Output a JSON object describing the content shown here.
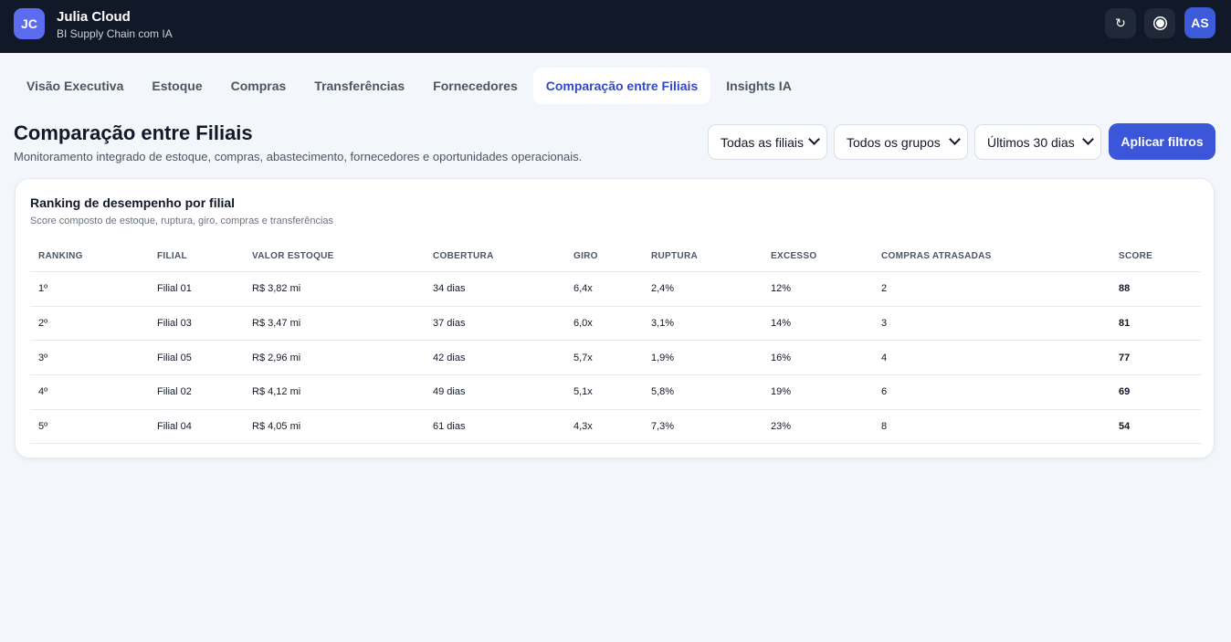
{
  "header": {
    "logo_initials": "JC",
    "app_name": "Julia Cloud",
    "app_subtitle": "BI Supply Chain com IA",
    "refresh_icon": "↻",
    "avatar_initials": "AS"
  },
  "tabs": [
    {
      "label": "Visão Executiva",
      "active": false
    },
    {
      "label": "Estoque",
      "active": false
    },
    {
      "label": "Compras",
      "active": false
    },
    {
      "label": "Transferências",
      "active": false
    },
    {
      "label": "Fornecedores",
      "active": false
    },
    {
      "label": "Comparação entre Filiais",
      "active": true
    },
    {
      "label": "Insights IA",
      "active": false
    }
  ],
  "page": {
    "title": "Comparação entre Filiais",
    "subtitle": "Monitoramento integrado de estoque, compras, abastecimento, fornecedores e oportunidades operacionais."
  },
  "filters": {
    "filiais": "Todas as filiais",
    "grupos": "Todos os grupos",
    "periodo": "Últimos 30 dias",
    "apply_label": "Aplicar filtros"
  },
  "ranking": {
    "title": "Ranking de desempenho por filial",
    "subtitle": "Score composto de estoque, ruptura, giro, compras e transferências",
    "columns": [
      "RANKING",
      "FILIAL",
      "VALOR ESTOQUE",
      "COBERTURA",
      "GIRO",
      "RUPTURA",
      "EXCESSO",
      "COMPRAS ATRASADAS",
      "SCORE"
    ],
    "rows": [
      [
        "1º",
        "Filial 01",
        "R$ 3,82 mi",
        "34 dias",
        "6,4x",
        "2,4%",
        "12%",
        "2",
        "88"
      ],
      [
        "2º",
        "Filial 03",
        "R$ 3,47 mi",
        "37 dias",
        "6,0x",
        "3,1%",
        "14%",
        "3",
        "81"
      ],
      [
        "3º",
        "Filial 05",
        "R$ 2,96 mi",
        "42 dias",
        "5,7x",
        "1,9%",
        "16%",
        "4",
        "77"
      ],
      [
        "4º",
        "Filial 02",
        "R$ 4,12 mi",
        "49 dias",
        "5,1x",
        "5,8%",
        "19%",
        "6",
        "69"
      ],
      [
        "5º",
        "Filial 04",
        "R$ 4,05 mi",
        "61 dias",
        "4,3x",
        "7,3%",
        "23%",
        "8",
        "54"
      ]
    ]
  }
}
